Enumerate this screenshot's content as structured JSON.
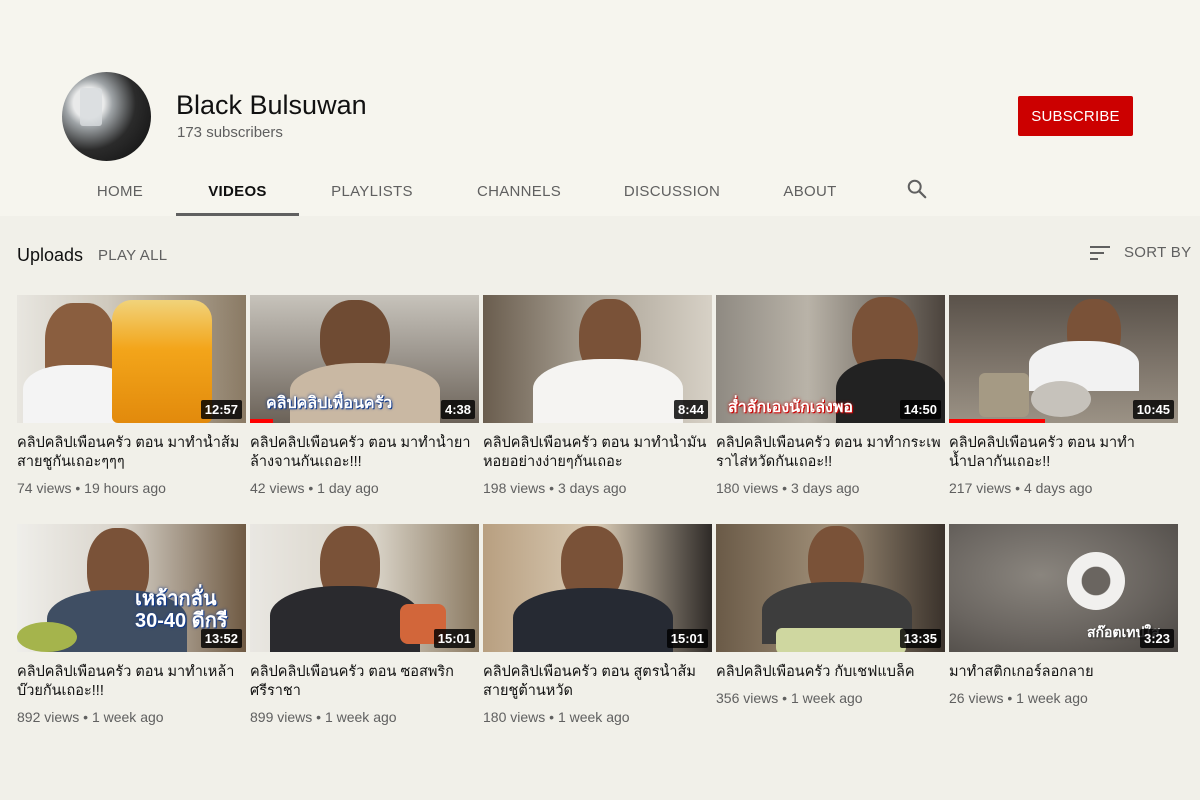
{
  "channel": {
    "name": "Black Bulsuwan",
    "subscribers": "173 subscribers",
    "subscribe_label": "SUBSCRIBE"
  },
  "tabs": [
    "HOME",
    "VIDEOS",
    "PLAYLISTS",
    "CHANNELS",
    "DISCUSSION",
    "ABOUT"
  ],
  "active_tab": "VIDEOS",
  "section": {
    "title": "Uploads",
    "play_all": "PLAY ALL",
    "sort_label": "SORT BY"
  },
  "videos": [
    {
      "title": "คลิปคลิปเพื่อนครัว ตอน มาทำน้ำส้มสายชูกันเถอะๆๆๆ",
      "views": "74 views",
      "age": "19 hours ago",
      "duration": "12:57",
      "overlay": "",
      "progress": 0
    },
    {
      "title": "คลิปคลิปเพื่อนครัว ตอน มาทำน้ำยาล้างจานกันเถอะ!!!",
      "views": "42 views",
      "age": "1 day ago",
      "duration": "4:38",
      "overlay": "คลิปคลิปเพื่อนครัว",
      "progress": 0.1
    },
    {
      "title": "คลิปคลิปเพื่อนครัว ตอน มาทำน้ำมันหอยอย่างง่ายๆกันเถอะ",
      "views": "198 views",
      "age": "3 days ago",
      "duration": "8:44",
      "overlay": "",
      "progress": 0
    },
    {
      "title": "คลิปคลิปเพื่อนครัว ตอน มาทำกระเพราไส่หวัดกันเถอะ!!",
      "views": "180 views",
      "age": "3 days ago",
      "duration": "14:50",
      "overlay": "ส่ำลักเองนักเล่งพอ",
      "progress": 0
    },
    {
      "title": "คลิปคลิปเพื่อนครัว ตอน มาทำน้ำปลากันเถอะ!!",
      "views": "217 views",
      "age": "4 days ago",
      "duration": "10:45",
      "overlay": "",
      "progress": 0.42
    },
    {
      "title": "คลิปคลิปเพื่อนครัว ตอน มาทำเหล้าบ๊วยกันเถอะ!!!",
      "views": "892 views",
      "age": "1 week ago",
      "duration": "13:52",
      "overlay": "เหล้ากลั่น 30-40 ดีกรี",
      "progress": 0
    },
    {
      "title": "คลิปคลิปเพื่อนครัว ตอน ซอสพริกศรีราชา",
      "views": "899 views",
      "age": "1 week ago",
      "duration": "15:01",
      "overlay": "",
      "progress": 0
    },
    {
      "title": "คลิปคลิปเพื่อนครัว ตอน สูตรน้ำส้มสายชูต้านหวัด",
      "views": "180 views",
      "age": "1 week ago",
      "duration": "15:01",
      "overlay": "",
      "progress": 0
    },
    {
      "title": "คลิปคลิปเพื่อนครัว กับเชฟแบล็ค",
      "views": "356 views",
      "age": "1 week ago",
      "duration": "13:35",
      "overlay": "",
      "progress": 0
    },
    {
      "title": "มาทำสติกเกอร์ลอกลาย",
      "views": "26 views",
      "age": "1 week ago",
      "duration": "3:23",
      "overlay": "สก๊อตเทปใส",
      "progress": 0
    }
  ],
  "colors": {
    "subscribe": "#cc0000",
    "progress": "#ff0000",
    "background": "#f1f0e9"
  },
  "icons": {
    "search": "search-icon",
    "sort": "sort-icon"
  }
}
